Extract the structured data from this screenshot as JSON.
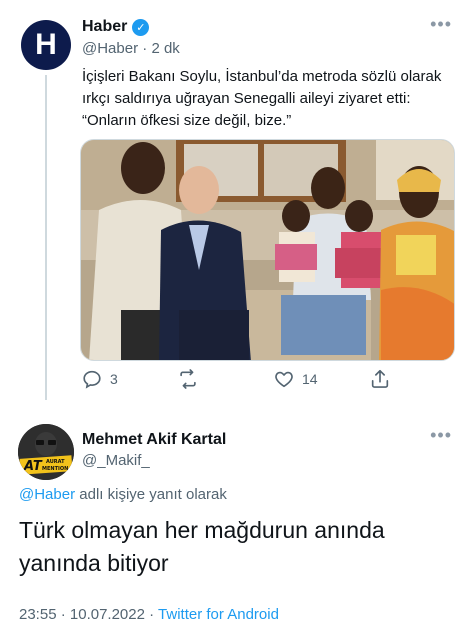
{
  "parent_tweet": {
    "avatar_letter": "H",
    "display_name": "Haber",
    "verified_mark": "✓",
    "handle": "@Haber",
    "separator": "·",
    "time_ago": "2 dk",
    "more_label": "•••",
    "text": "İçişleri Bakanı Soylu, İstanbul’da metroda sözlü olarak ırkçı saldırıya uğrayan Senegalli aileyi ziyaret etti: “Onların öfkesi size değil, bize.”",
    "actions": {
      "reply_count": "3",
      "retweet_count": "",
      "like_count": "14",
      "icons": [
        "reply-icon",
        "retweet-icon",
        "like-icon",
        "share-icon"
      ]
    }
  },
  "reply_tweet": {
    "avatar_text_top": "AT",
    "avatar_text_small_1": "AURAT",
    "avatar_text_small_2": "MENTION",
    "display_name": "Mehmet Akif Kartal",
    "handle": "@_Makif_",
    "more_label": "•••",
    "replying_mention": "@Haber",
    "replying_suffix": " adlı kişiye yanıt olarak",
    "text": "Türk olmayan her mağdurun anında yanında bitiyor",
    "time": "23:55",
    "separator": "·",
    "date": "10.07.2022",
    "source": "Twitter for Android"
  },
  "colors": {
    "accent": "#1d9bf0",
    "secondary_text": "#536471",
    "primary_text": "#0f1419",
    "avatar_bg": "#0d1b4c"
  }
}
